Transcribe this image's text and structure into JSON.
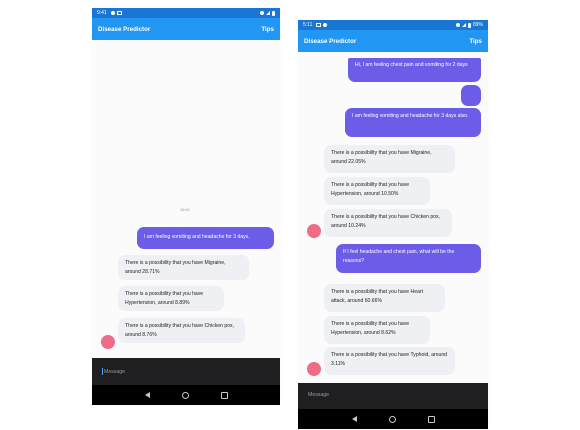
{
  "left": {
    "status": {
      "time": "9:41"
    },
    "app_bar": {
      "title": "Disease Predictor",
      "tips": "Tips"
    },
    "timestamp": "19:41",
    "messages": [
      {
        "role": "user",
        "text": "I am feeling vomiting and headache for 3 days."
      },
      {
        "role": "bot",
        "text": "There is a possibility that you have Migraine, around 28.71%"
      },
      {
        "role": "bot",
        "text": "There is a possibility that you have Hypertension, around 8.89%"
      },
      {
        "role": "bot",
        "text": "There is a possibility that you have Chicken pox, around 8.76%"
      }
    ],
    "input": {
      "placeholder": "Message"
    }
  },
  "right": {
    "status": {
      "time": "5:11",
      "battery": "89%"
    },
    "app_bar": {
      "title": "Disease Predictor",
      "tips": "Tips"
    },
    "messages": [
      {
        "role": "user",
        "text": "Hi, I am feeling chest pain and vomiting for 2 days"
      },
      {
        "role": "user",
        "text": ""
      },
      {
        "role": "user",
        "text": "I am feeling vomiting and headache for 3 days also."
      },
      {
        "role": "bot",
        "text": "There is a possibility that you have Migraine, around 22.05%"
      },
      {
        "role": "bot",
        "text": "There is a possibility that you have Hypertension, around 10.50%"
      },
      {
        "role": "bot",
        "text": "There is a possibility that you have Chicken pox, around 10.24%"
      },
      {
        "role": "user",
        "text": "If I  feel headache and chest pain, what will be the reasons?"
      },
      {
        "role": "bot",
        "text": "There is a possibility that you have Heart attack, around 60.66%"
      },
      {
        "role": "bot",
        "text": "There is a possibility that you have Hypertension, around 8.62%"
      },
      {
        "role": "bot",
        "text": "There is a possibility that you have Typhoid, around 3.11%"
      }
    ],
    "input": {
      "placeholder": "Message"
    }
  },
  "colors": {
    "app_bar": "#2196f3",
    "user_bubble": "#6c5ce7",
    "bot_bubble": "#eef0f3",
    "avatar": "#f06c86"
  }
}
